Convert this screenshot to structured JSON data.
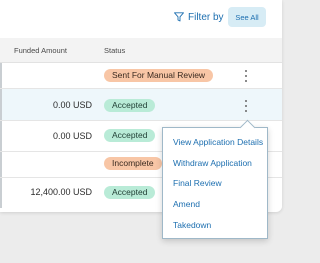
{
  "toolbar": {
    "filter_label": "Filter by",
    "see_all_label": "See All"
  },
  "table": {
    "columns": {
      "funded_amount": "Funded Amount",
      "status": "Status"
    },
    "rows": [
      {
        "amount": "",
        "status": "Sent For Manual Review",
        "status_color": "#f8c6a6"
      },
      {
        "amount": "0.00 USD",
        "status": "Accepted",
        "status_color": "#b9ebd7"
      },
      {
        "amount": "0.00 USD",
        "status": "Accepted",
        "status_color": "#b9ebd7"
      },
      {
        "amount": "",
        "status": "Incomplete",
        "status_color": "#f8c6a6"
      },
      {
        "amount": "12,400.00 USD",
        "status": "Accepted",
        "status_color": "#b9ebd7"
      }
    ]
  },
  "context_menu": {
    "items": [
      "View Application Details",
      "Withdraw Application",
      "Final Review",
      "Amend",
      "Takedown"
    ]
  },
  "colors": {
    "accent": "#1d6fb0",
    "badge_orange": "#f8c6a6",
    "badge_green": "#b9ebd7",
    "selected_row": "#eef7fb"
  }
}
